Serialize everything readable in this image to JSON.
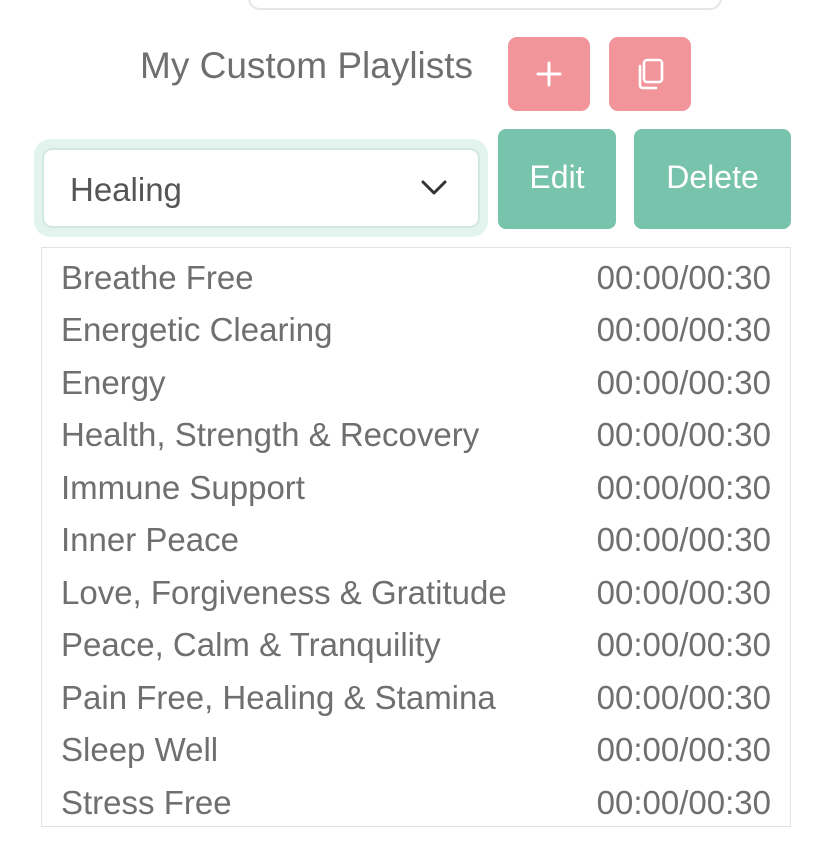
{
  "header": {
    "title": "My Custom Playlists",
    "add_icon": "plus-icon",
    "copy_icon": "copy-icon"
  },
  "playlist_select": {
    "selected": "Healing",
    "icon": "chevron-down-icon"
  },
  "actions": {
    "edit_label": "Edit",
    "delete_label": "Delete"
  },
  "tracks": [
    {
      "name": "Breathe Free",
      "time": "00:00/00:30"
    },
    {
      "name": "Energetic Clearing",
      "time": "00:00/00:30"
    },
    {
      "name": "Energy",
      "time": "00:00/00:30"
    },
    {
      "name": "Health, Strength & Recovery",
      "time": "00:00/00:30"
    },
    {
      "name": "Immune Support",
      "time": "00:00/00:30"
    },
    {
      "name": "Inner Peace",
      "time": "00:00/00:30"
    },
    {
      "name": "Love, Forgiveness & Gratitude",
      "time": "00:00/00:30"
    },
    {
      "name": "Peace, Calm & Tranquility",
      "time": "00:00/00:30"
    },
    {
      "name": "Pain Free, Healing & Stamina",
      "time": "00:00/00:30"
    },
    {
      "name": "Sleep Well",
      "time": "00:00/00:30"
    },
    {
      "name": "Stress Free",
      "time": "00:00/00:30"
    }
  ],
  "colors": {
    "pink_button": "#f2959a",
    "green_button": "#78c3ab",
    "text": "#6f6f6f"
  }
}
